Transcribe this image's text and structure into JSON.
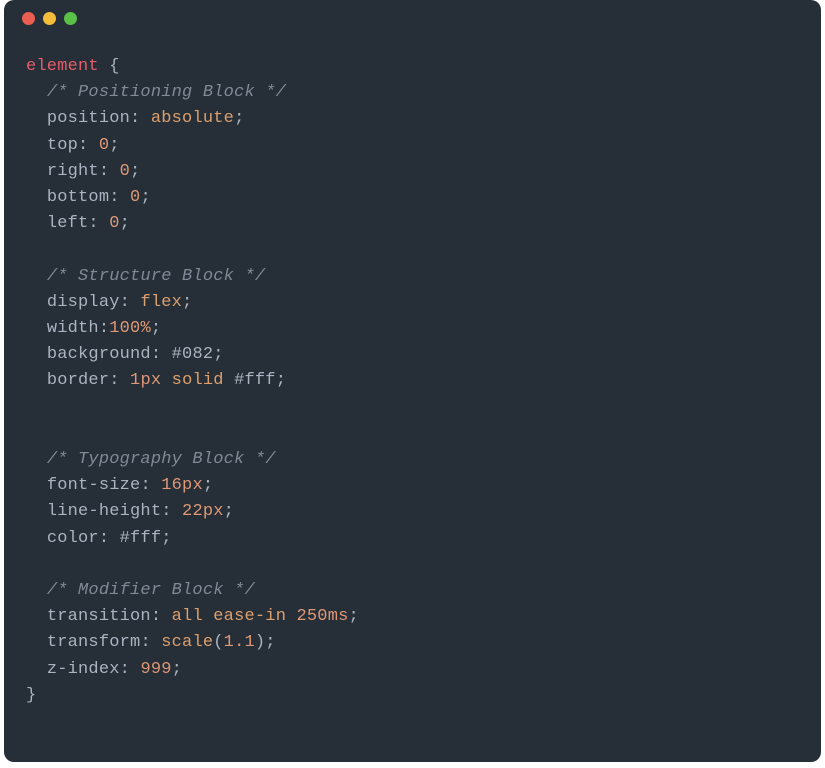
{
  "traffic_lights": [
    "close",
    "minimize",
    "zoom"
  ],
  "code": {
    "selector": "element",
    "open_brace": "{",
    "close_brace": "}",
    "blocks": [
      {
        "comment": "/* Positioning Block */",
        "decls": [
          {
            "prop": "position",
            "segs": [
              {
                "t": "absolute",
                "c": "val-kw"
              }
            ]
          },
          {
            "prop": "top",
            "segs": [
              {
                "t": "0",
                "c": "val-num"
              }
            ]
          },
          {
            "prop": "right",
            "segs": [
              {
                "t": "0",
                "c": "val-num"
              }
            ]
          },
          {
            "prop": "bottom",
            "segs": [
              {
                "t": "0",
                "c": "val-num"
              }
            ]
          },
          {
            "prop": "left",
            "segs": [
              {
                "t": "0",
                "c": "val-num"
              }
            ]
          }
        ]
      },
      {
        "comment": "/* Structure Block */",
        "decls": [
          {
            "prop": "display",
            "segs": [
              {
                "t": "flex",
                "c": "val-kw"
              }
            ]
          },
          {
            "prop": "width",
            "nospace": true,
            "segs": [
              {
                "t": "100%",
                "c": "val-num"
              }
            ]
          },
          {
            "prop": "background",
            "segs": [
              {
                "t": "#082",
                "c": "val-hex"
              }
            ]
          },
          {
            "prop": "border",
            "segs": [
              {
                "t": "1px",
                "c": "val-num"
              },
              {
                "t": " ",
                "c": "punct"
              },
              {
                "t": "solid",
                "c": "val-kw"
              },
              {
                "t": " ",
                "c": "punct"
              },
              {
                "t": "#fff",
                "c": "val-hex"
              }
            ]
          }
        ],
        "trailing_blank": true
      },
      {
        "comment": "/* Typography Block */",
        "decls": [
          {
            "prop": "font-size",
            "segs": [
              {
                "t": "16px",
                "c": "val-num"
              }
            ]
          },
          {
            "prop": "line-height",
            "segs": [
              {
                "t": "22px",
                "c": "val-num"
              }
            ]
          },
          {
            "prop": "color",
            "segs": [
              {
                "t": "#fff",
                "c": "val-hex"
              }
            ]
          }
        ]
      },
      {
        "comment": "/* Modifier Block */",
        "decls": [
          {
            "prop": "transition",
            "segs": [
              {
                "t": "all",
                "c": "val-kw"
              },
              {
                "t": " ",
                "c": "punct"
              },
              {
                "t": "ease-in",
                "c": "val-kw"
              },
              {
                "t": " ",
                "c": "punct"
              },
              {
                "t": "250ms",
                "c": "val-num"
              }
            ]
          },
          {
            "prop": "transform",
            "segs": [
              {
                "t": "scale",
                "c": "val-kw"
              },
              {
                "t": "(",
                "c": "punct"
              },
              {
                "t": "1.1",
                "c": "val-num"
              },
              {
                "t": ")",
                "c": "punct"
              }
            ]
          },
          {
            "prop": "z-index",
            "segs": [
              {
                "t": "999",
                "c": "val-num"
              }
            ]
          }
        ]
      }
    ]
  }
}
